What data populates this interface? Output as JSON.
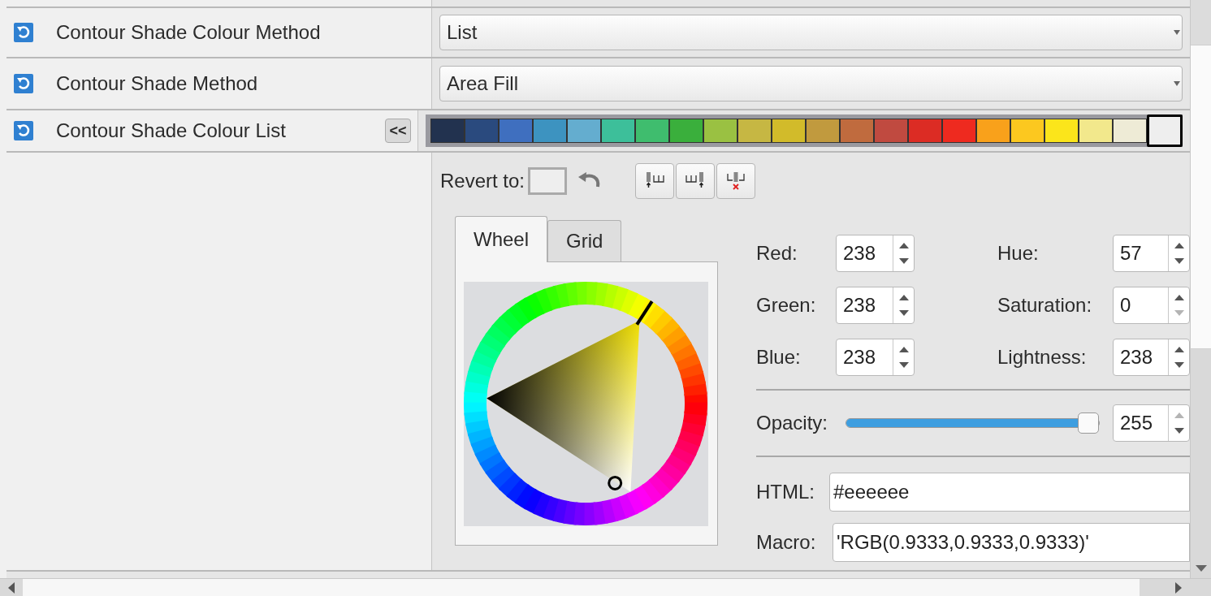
{
  "properties": [
    {
      "label": "Contour Shade Colour Method",
      "kind": "combo",
      "value": "List"
    },
    {
      "label": "Contour Shade Method",
      "kind": "combo",
      "value": "Area Fill"
    },
    {
      "label": "Contour Shade Colour List",
      "kind": "swatches",
      "collapse_button": "<<",
      "swatches": [
        {
          "color": "#22324f",
          "selected": false
        },
        {
          "color": "#2a4a7e",
          "selected": false
        },
        {
          "color": "#3f6fbf",
          "selected": false
        },
        {
          "color": "#3d93c0",
          "selected": false
        },
        {
          "color": "#64adcf",
          "selected": false
        },
        {
          "color": "#3dbf9a",
          "selected": false
        },
        {
          "color": "#3fbd6e",
          "selected": false
        },
        {
          "color": "#3aaf3c",
          "selected": false
        },
        {
          "color": "#9ac142",
          "selected": false
        },
        {
          "color": "#c6b743",
          "selected": false
        },
        {
          "color": "#d2bb2a",
          "selected": false
        },
        {
          "color": "#c19a3e",
          "selected": false
        },
        {
          "color": "#c06b3e",
          "selected": false
        },
        {
          "color": "#c04a40",
          "selected": false
        },
        {
          "color": "#dc2c24",
          "selected": false
        },
        {
          "color": "#ee2a1f",
          "selected": false
        },
        {
          "color": "#f9a11b",
          "selected": false
        },
        {
          "color": "#fcc81f",
          "selected": false
        },
        {
          "color": "#fbe51b",
          "selected": false
        },
        {
          "color": "#f2e88c",
          "selected": false
        },
        {
          "color": "#eeebd6",
          "selected": false
        },
        {
          "color": "#eeeeee",
          "selected": true
        }
      ]
    }
  ],
  "editor": {
    "revert_label": "Revert to:",
    "tabs": [
      {
        "label": "Wheel",
        "selected": true
      },
      {
        "label": "Grid",
        "selected": false
      }
    ],
    "rgb": [
      {
        "label": "Red:",
        "value": "238",
        "up_disabled": false,
        "down_disabled": false
      },
      {
        "label": "Green:",
        "value": "238",
        "up_disabled": false,
        "down_disabled": false
      },
      {
        "label": "Blue:",
        "value": "238",
        "up_disabled": false,
        "down_disabled": false
      }
    ],
    "hsl": [
      {
        "label": "Hue:",
        "value": "57",
        "up_disabled": false,
        "down_disabled": false
      },
      {
        "label": "Saturation:",
        "value": "0",
        "up_disabled": false,
        "down_disabled": true
      },
      {
        "label": "Lightness:",
        "value": "238",
        "up_disabled": false,
        "down_disabled": false
      }
    ],
    "opacity": {
      "label": "Opacity:",
      "level": 1,
      "value": "255",
      "up_disabled": true,
      "down_disabled": false
    },
    "html": {
      "label": "HTML:",
      "value": "#eeeeee"
    },
    "macro": {
      "label": "Macro:",
      "value": "'RGB(0.9333,0.9333,0.9333)'"
    }
  }
}
